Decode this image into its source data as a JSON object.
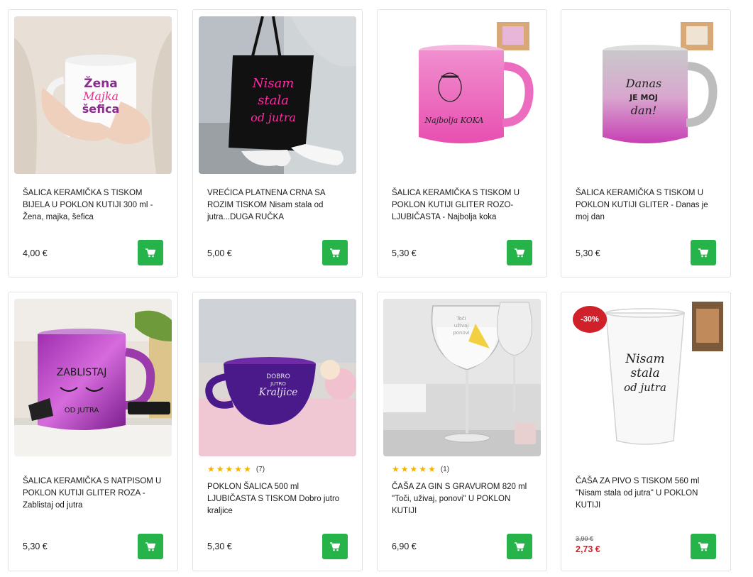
{
  "products": [
    {
      "title": "ŠALICA KERAMIČKA S TISKOM BIJELA U POKLON KUTIJI 300 ml - Žena, majka, šefica",
      "price": "4,00 €",
      "image": "white-mug-hands",
      "print": [
        "Žena",
        "Majka",
        "šefica"
      ]
    },
    {
      "title": "VREĆICA PLATNENA CRNA SA ROZIM TISKOM Nisam stala od jutra...DUGA RUČKA",
      "price": "5,00 €",
      "image": "black-tote-bag",
      "print": [
        "Nisam",
        "stala",
        "od jutra"
      ]
    },
    {
      "title": "ŠALICA KERAMIČKA S TISKOM U POKLON KUTIJI GLITER ROZO-LJUBIČASTA - Najbolja koka",
      "price": "5,30 €",
      "image": "pink-glitter-mug",
      "print": [
        "Najbolja KOKA"
      ]
    },
    {
      "title": "ŠALICA KERAMIČKA S TISKOM U POKLON KUTIJI GLITER - Danas je moj dan",
      "price": "5,30 €",
      "image": "silver-pink-glitter-mug",
      "print": [
        "Danas",
        "JE MOJ",
        "dan!"
      ]
    },
    {
      "title": "ŠALICA KERAMIČKA S NATPISOM U POKLON KUTIJI GLITER ROZA - Zablistaj od jutra",
      "price": "5,30 €",
      "image": "purple-glitter-mug",
      "print": [
        "ZABLISTAJ",
        "OD JUTRA"
      ]
    },
    {
      "title": "POKLON ŠALICA 500 ml LJUBIČASTA S TISKOM Dobro jutro kraljice",
      "price": "5,30 €",
      "image": "purple-large-mug",
      "rating": {
        "stars": 5,
        "count": "(7)"
      },
      "print": [
        "DOBRO",
        "JUTRO",
        "Kraljice"
      ]
    },
    {
      "title": "ČAŠA ZA GIN S GRAVUROM 820 ml \"Toči, uživaj, ponovi\" U POKLON KUTIJI",
      "price": "6,90 €",
      "image": "gin-glass",
      "rating": {
        "stars": 5,
        "count": "(1)"
      },
      "print": [
        "Toči",
        "uživaj",
        "ponovi"
      ]
    },
    {
      "title": "ČAŠA ZA PIVO S TISKOM 560 ml \"Nisam stala od jutra\" U POKLON KUTIJI",
      "old_price": "3,90 €",
      "price": "2,73 €",
      "discount": "-30%",
      "image": "beer-glass",
      "print": [
        "Nisam",
        "stala",
        "od jutra"
      ]
    }
  ],
  "colors": {
    "cart_button": "#26b34a",
    "discount_badge": "#d0202a",
    "star": "#f5b301"
  },
  "icons": {
    "cart": "cart-icon",
    "star": "star-icon"
  }
}
